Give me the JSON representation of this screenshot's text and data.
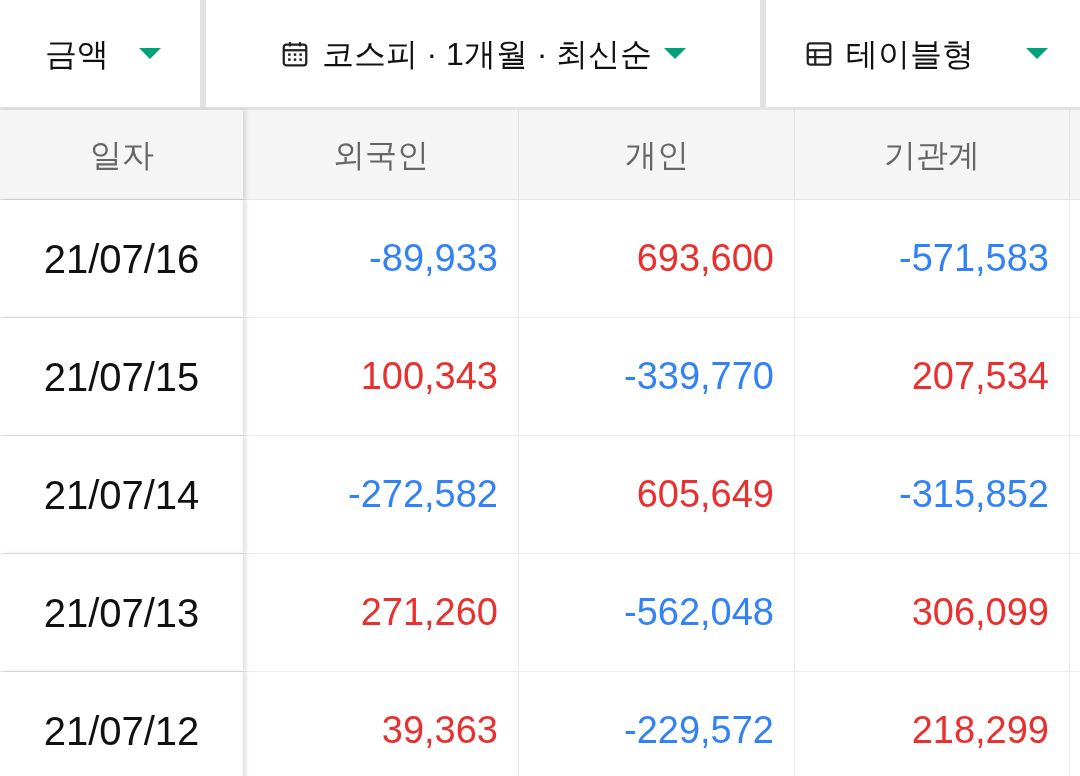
{
  "filters": [
    {
      "kind": "plain",
      "label": "금액"
    },
    {
      "kind": "calendar",
      "label": "코스피 · 1개월 · 최신순"
    },
    {
      "kind": "table",
      "label": "테이블형"
    }
  ],
  "table": {
    "columns": [
      "일자",
      "외국인",
      "개인",
      "기관계"
    ],
    "rows": [
      {
        "cells": [
          {
            "value": "21/07/16"
          },
          {
            "value": "-89,933",
            "color": "#3182f6"
          },
          {
            "value": "693,600",
            "color": "#e8302e"
          },
          {
            "value": "-571,583",
            "color": "#3182f6"
          }
        ]
      },
      {
        "cells": [
          {
            "value": "21/07/15"
          },
          {
            "value": "100,343",
            "color": "#e8302e"
          },
          {
            "value": "-339,770",
            "color": "#3182f6"
          },
          {
            "value": "207,534",
            "color": "#e8302e"
          }
        ]
      },
      {
        "cells": [
          {
            "value": "21/07/14"
          },
          {
            "value": "-272,582",
            "color": "#3182f6"
          },
          {
            "value": "605,649",
            "color": "#e8302e"
          },
          {
            "value": "-315,852",
            "color": "#3182f6"
          }
        ]
      },
      {
        "cells": [
          {
            "value": "21/07/13"
          },
          {
            "value": "271,260",
            "color": "#e8302e"
          },
          {
            "value": "-562,048",
            "color": "#3182f6"
          },
          {
            "value": "306,099",
            "color": "#e8302e"
          }
        ]
      },
      {
        "cells": [
          {
            "value": "21/07/12"
          },
          {
            "value": "39,363",
            "color": "#e8302e"
          },
          {
            "value": "-229,572",
            "color": "#3182f6"
          },
          {
            "value": "218,299",
            "color": "#e8302e"
          }
        ]
      }
    ]
  }
}
